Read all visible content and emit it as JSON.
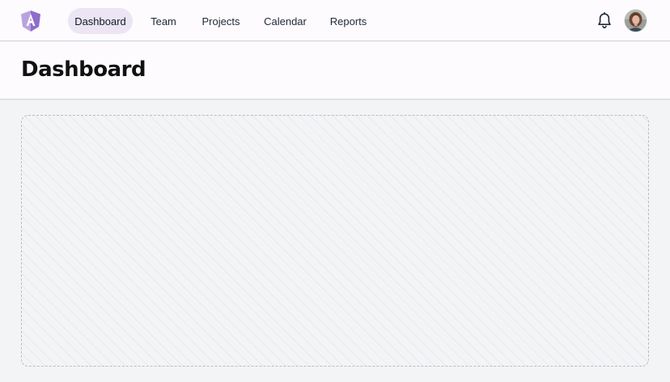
{
  "nav": {
    "items": [
      {
        "label": "Dashboard",
        "active": true
      },
      {
        "label": "Team",
        "active": false
      },
      {
        "label": "Projects",
        "active": false
      },
      {
        "label": "Calendar",
        "active": false
      },
      {
        "label": "Reports",
        "active": false
      }
    ]
  },
  "icons": {
    "logo": "brand-logo-icon",
    "notifications": "bell-icon",
    "user": "avatar"
  },
  "header": {
    "title": "Dashboard"
  },
  "colors": {
    "accent": "#8a63c6",
    "active_nav_bg": "#ebe5f4",
    "page_bg": "#f3f4f6",
    "surface": "#fdfbfe"
  }
}
